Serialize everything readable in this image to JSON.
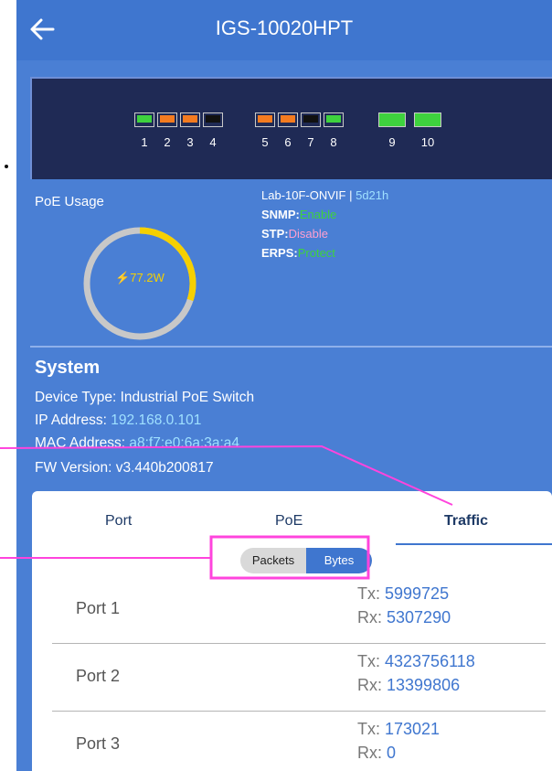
{
  "header": {
    "title": "IGS-10020HPT",
    "back_icon": "arrow-left-icon"
  },
  "ports": [
    {
      "label": "1",
      "status": "green"
    },
    {
      "label": "2",
      "status": "orange"
    },
    {
      "label": "3",
      "status": "orange"
    },
    {
      "label": "4",
      "status": "black"
    },
    {
      "label": "5",
      "status": "orange"
    },
    {
      "label": "6",
      "status": "orange"
    },
    {
      "label": "7",
      "status": "black"
    },
    {
      "label": "8",
      "status": "green"
    }
  ],
  "sfp_ports": [
    {
      "label": "9",
      "status": "green"
    },
    {
      "label": "10",
      "status": "green"
    }
  ],
  "poe": {
    "label": "PoE Usage",
    "value": "77.2W",
    "usage_fraction": 0.3
  },
  "device_info": {
    "name": "Lab-10F-ONVIF",
    "separator": " | ",
    "uptime": "5d21h",
    "snmp_label": "SNMP:",
    "snmp_value": "Enable",
    "stp_label": "STP:",
    "stp_value": "Disable",
    "erps_label": "ERPS:",
    "erps_value": "Protect"
  },
  "system": {
    "title": "System",
    "device_type_label": "Device Type: ",
    "device_type": "Industrial PoE Switch",
    "ip_label": "IP Address: ",
    "ip": "192.168.0.101",
    "mac_label": "MAC Address: ",
    "mac": "a8:f7:e0:6a:3a:a4",
    "fw_label": "FW Version:  ",
    "fw": "v3.440b200817"
  },
  "tabs": [
    "Port",
    "PoE",
    "Traffic"
  ],
  "active_tab": "Traffic",
  "toggle": {
    "left": "Packets",
    "right": "Bytes",
    "selected": "Bytes"
  },
  "traffic_rows": [
    {
      "port": "Port 1",
      "tx_label": "Tx: ",
      "tx": "5999725",
      "rx_label": "Rx: ",
      "rx": "5307290"
    },
    {
      "port": "Port 2",
      "tx_label": "Tx: ",
      "tx": "4323756118",
      "rx_label": "Rx: ",
      "rx": "13399806"
    },
    {
      "port": "Port 3",
      "tx_label": "Tx: ",
      "tx": "173021",
      "rx_label": "Rx: ",
      "rx": "0"
    }
  ],
  "colors": {
    "accent": "#3f76cf",
    "background": "#4a7fd4",
    "annotation": "#ff44dd",
    "enable": "#3ed23e",
    "disable": "#ff9fd0",
    "gauge": "#f5d000"
  }
}
